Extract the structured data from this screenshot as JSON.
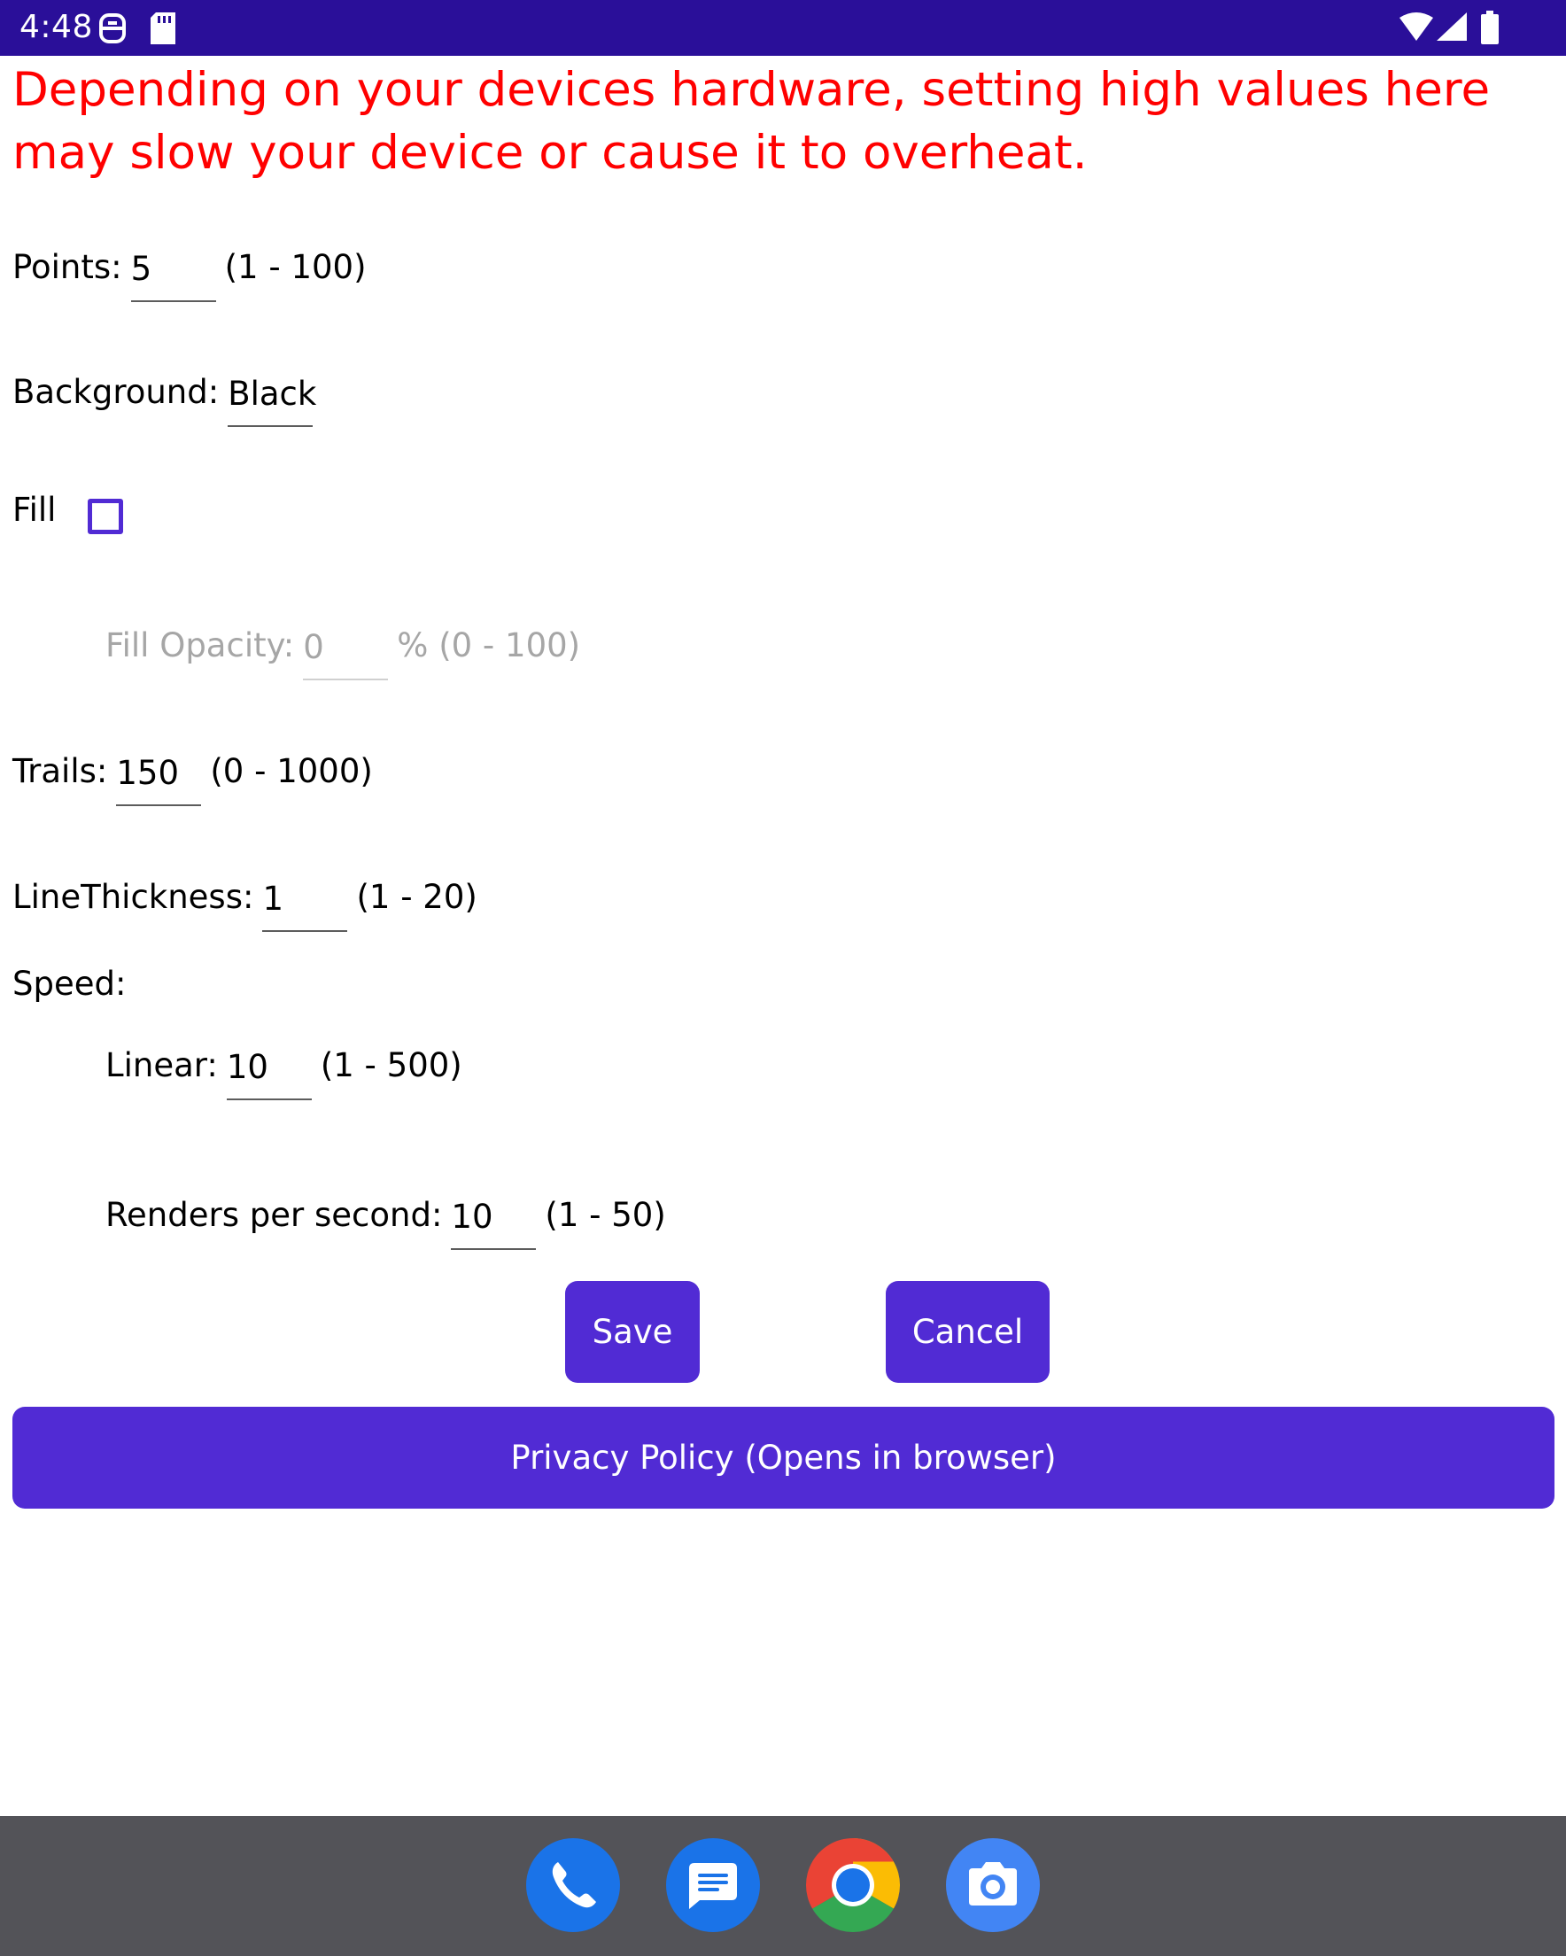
{
  "status_bar": {
    "time": "4:48",
    "left_icons": [
      "sim-security-icon",
      "sd-card-icon"
    ],
    "right_icons": [
      "wifi-icon",
      "cell-signal-icon",
      "battery-icon"
    ]
  },
  "warning": "Depending on your devices hardware, setting high values here may slow your device or cause it to overheat.",
  "settings": {
    "points": {
      "label": "Points:",
      "value": "5",
      "range": "(1 - 100)"
    },
    "background": {
      "label": "Background:",
      "value": "Black"
    },
    "fill": {
      "label": "Fill",
      "checked": false
    },
    "fill_opacity": {
      "label": "Fill Opacity:",
      "value": "0",
      "range": "% (0 - 100)"
    },
    "trails": {
      "label": "Trails:",
      "value": "150",
      "range": "(0 - 1000)"
    },
    "line_thickness": {
      "label": "LineThickness:",
      "value": "1",
      "range": "(1 - 20)"
    },
    "speed": {
      "label": "Speed:"
    },
    "linear": {
      "label": "Linear:",
      "value": "10",
      "range": "(1 - 500)"
    },
    "renders": {
      "label": "Renders per second:",
      "value": "10",
      "range": "(1 - 50)"
    }
  },
  "buttons": {
    "save": "Save",
    "cancel": "Cancel",
    "privacy": "Privacy Policy (Opens in browser)"
  },
  "dock": {
    "apps": [
      "phone-icon",
      "messages-icon",
      "chrome-icon",
      "camera-icon"
    ]
  },
  "colors": {
    "status_bar": "#2a0f99",
    "accent": "#512bd4",
    "warning": "#ff0000",
    "dock": "#535358"
  }
}
